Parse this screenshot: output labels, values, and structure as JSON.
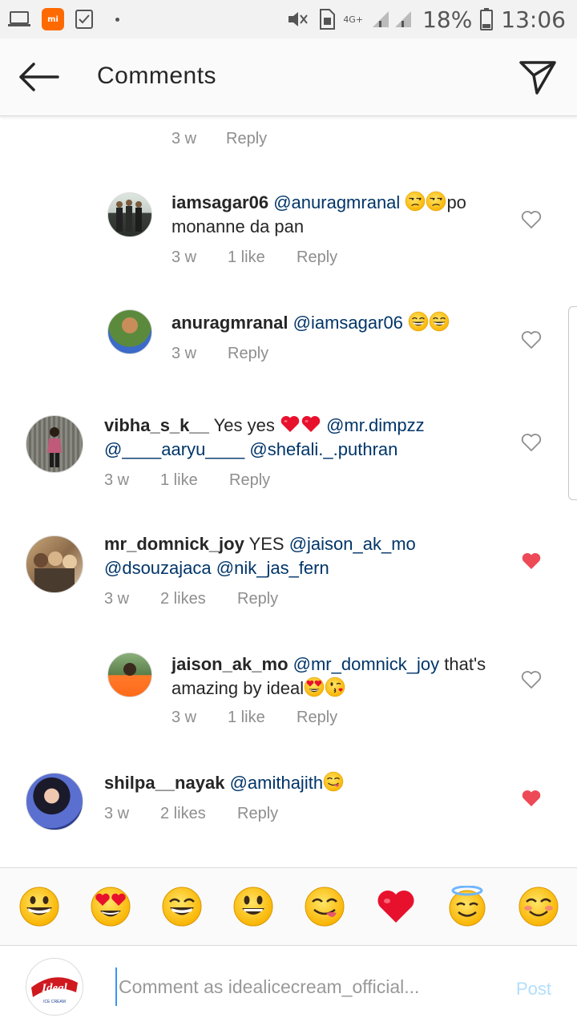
{
  "status_bar": {
    "battery": "18%",
    "time": "13:06",
    "network": "4G+",
    "icons": [
      "laptop-icon",
      "mi-app-icon",
      "checklist-icon",
      "mute-icon",
      "sim-icon",
      "signal-icon",
      "battery-icon"
    ],
    "mi_label": "mi"
  },
  "header": {
    "title": "Comments",
    "back_icon": "arrow-left-icon",
    "send_icon": "paper-plane-icon"
  },
  "top_partial": {
    "time": "3 w",
    "reply": "Reply"
  },
  "comments": [
    {
      "username": "iamsagar06",
      "segments": [
        {
          "text": "@anuragmranal",
          "mention": true
        },
        {
          "text": " "
        },
        {
          "emoji": "unamused-face"
        },
        {
          "emoji": "unamused-face"
        },
        {
          "text": "po monanne da pan"
        }
      ],
      "time": "3 w",
      "likes": "1 like",
      "reply": "Reply",
      "liked": false
    },
    {
      "username": "anuragmranal",
      "segments": [
        {
          "text": "@iamsagar06",
          "mention": true
        },
        {
          "text": " "
        },
        {
          "emoji": "grinning-squint-face"
        },
        {
          "emoji": "grinning-squint-face"
        }
      ],
      "time": "3 w",
      "likes": "",
      "reply": "Reply",
      "liked": false
    },
    {
      "username": "vibha_s_k__",
      "segments": [
        {
          "text": "Yes yes "
        },
        {
          "emoji": "red-heart"
        },
        {
          "emoji": "red-heart"
        },
        {
          "text": " "
        },
        {
          "text": "@mr.dimpzz",
          "mention": true
        },
        {
          "text": " "
        },
        {
          "text": "@____aaryu____",
          "mention": true
        },
        {
          "text": " "
        },
        {
          "text": "@shefali._.puthran",
          "mention": true
        }
      ],
      "time": "3 w",
      "likes": "1 like",
      "reply": "Reply",
      "liked": false
    },
    {
      "username": "mr_domnick_joy",
      "segments": [
        {
          "text": "YES "
        },
        {
          "text": "@jaison_ak_mo",
          "mention": true
        },
        {
          "text": " "
        },
        {
          "text": "@dsouzajaca",
          "mention": true
        },
        {
          "text": " "
        },
        {
          "text": "@nik_jas_fern",
          "mention": true
        }
      ],
      "time": "3 w",
      "likes": "2 likes",
      "reply": "Reply",
      "liked": true
    },
    {
      "username": "jaison_ak_mo",
      "segments": [
        {
          "text": "@mr_domnick_joy",
          "mention": true
        },
        {
          "text": " that's amazing by ideal"
        },
        {
          "emoji": "heart-eyes-face"
        },
        {
          "emoji": "kissing-face"
        }
      ],
      "time": "3 w",
      "likes": "1 like",
      "reply": "Reply",
      "liked": false
    },
    {
      "username": "shilpa__nayak",
      "segments": [
        {
          "text": "@amithajith",
          "mention": true
        },
        {
          "emoji": "yum-face"
        }
      ],
      "time": "3 w",
      "likes": "2 likes",
      "reply": "Reply",
      "liked": true
    }
  ],
  "emoji_bar": [
    "grinning-face",
    "heart-eyes-face",
    "grinning-squint-face",
    "smiley-face",
    "yum-face",
    "red-heart",
    "halo-face",
    "blush-face"
  ],
  "input": {
    "placeholder": "Comment as idealicecream_official...",
    "post_label": "Post",
    "avatar_brand": "Ideal",
    "avatar_sub": "ICE CREAM"
  },
  "colors": {
    "mention": "#003569",
    "heart_liked": "#ed4956",
    "post_disabled": "#b2dffc",
    "meta_gray": "#8e8e8e"
  }
}
